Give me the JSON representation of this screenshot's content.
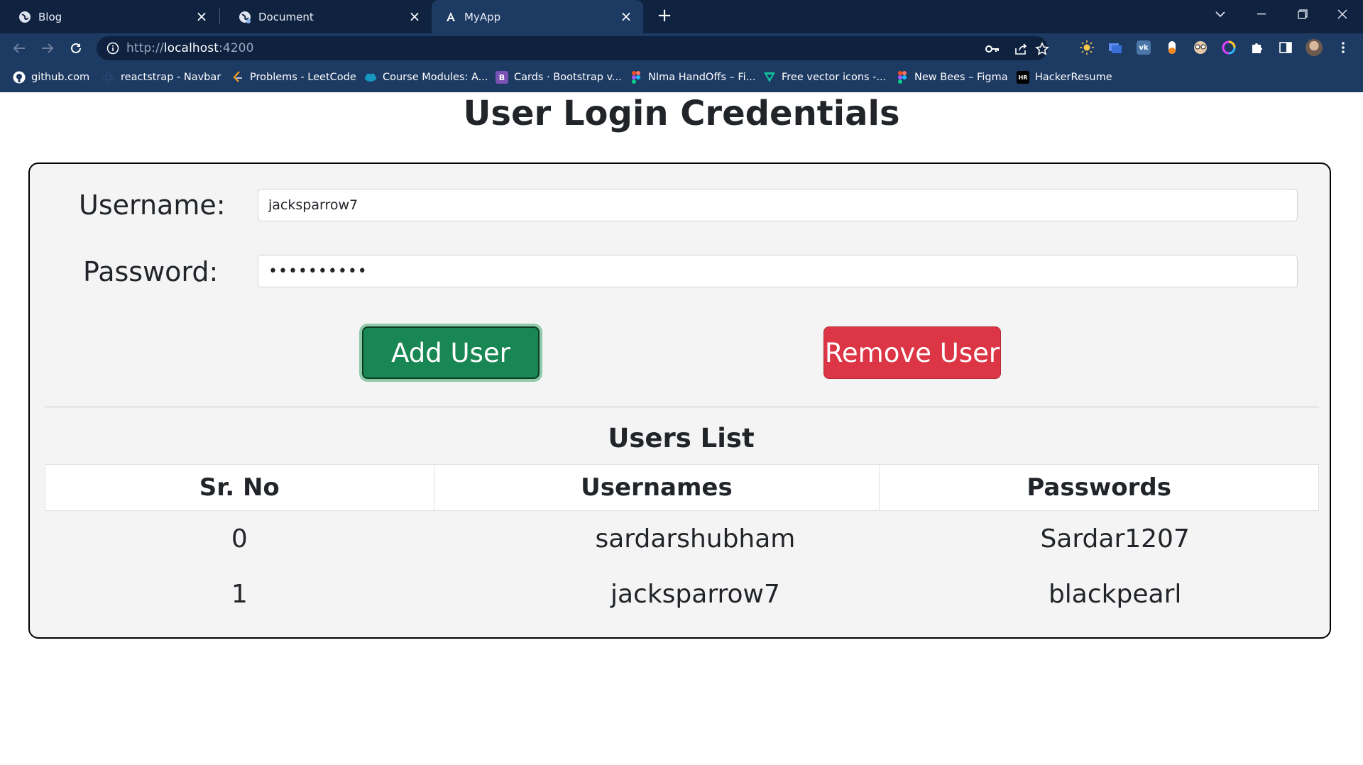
{
  "browser": {
    "tabs": [
      {
        "title": "Blog",
        "icon": "globe-icon",
        "active": false
      },
      {
        "title": "Document",
        "icon": "globe-icon",
        "active": false
      },
      {
        "title": "MyApp",
        "icon": "angular-icon",
        "active": true
      }
    ],
    "url_scheme": "http://",
    "url_host": "localhost",
    "url_port": ":4200",
    "bookmarks": [
      {
        "label": "github.com",
        "icon": "github-icon"
      },
      {
        "label": "reactstrap - Navbar",
        "icon": "reactstrap-icon"
      },
      {
        "label": "Problems - LeetCode",
        "icon": "leetcode-icon"
      },
      {
        "label": "Course Modules: A...",
        "icon": "salesforce-cloud-icon"
      },
      {
        "label": "Cards · Bootstrap v...",
        "icon": "bootstrap-icon"
      },
      {
        "label": "NIma HandOffs – Fi...",
        "icon": "figma-icon"
      },
      {
        "label": "Free vector icons -...",
        "icon": "flaticon-icon"
      },
      {
        "label": "New Bees – Figma",
        "icon": "figma-icon"
      },
      {
        "label": "HackerResume",
        "icon": "hackerresume-icon"
      }
    ],
    "colors": {
      "tabbar": "#0f2341",
      "toolbar": "#1d3a63"
    }
  },
  "page": {
    "title": "User Login Credentials",
    "username_label": "Username:",
    "username_value": "jacksparrow7",
    "password_label": "Password:",
    "password_value": "blackpearl",
    "add_button": "Add User",
    "remove_button": "Remove User",
    "list_title": "Users List",
    "columns": [
      "Sr. No",
      "Usernames",
      "Passwords"
    ],
    "rows": [
      [
        "0",
        "sardarshubham",
        "Sardar1207"
      ],
      [
        "1",
        "jacksparrow7",
        "blackpearl"
      ]
    ],
    "colors": {
      "add": "#198754",
      "remove": "#dc3545"
    }
  }
}
